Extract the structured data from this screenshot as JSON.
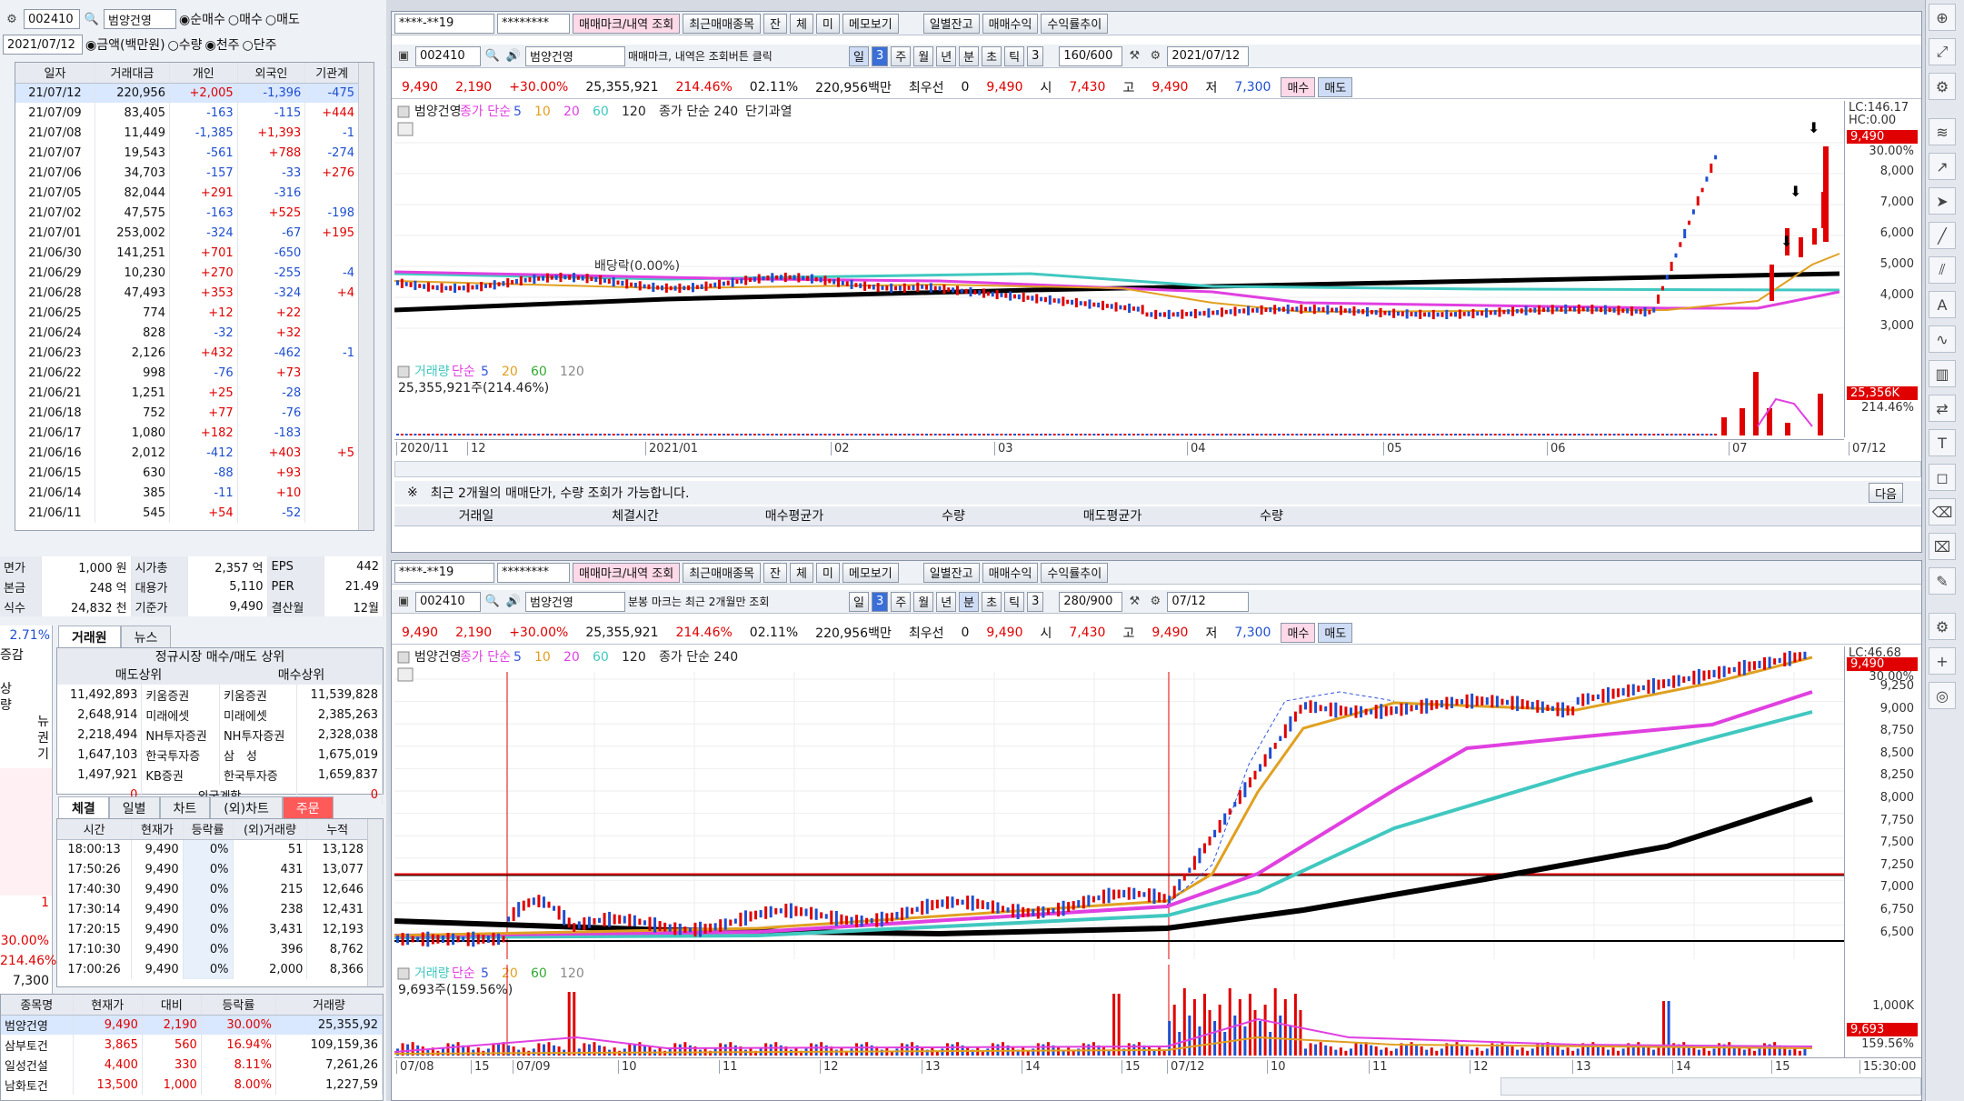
{
  "colors": {
    "up": "#e00000",
    "down": "#1e4fd0",
    "ma5": "#3355dd",
    "ma10": "#e0a020",
    "ma20": "#e040e0",
    "ma60": "#40c8c0",
    "ma240": "#000000"
  },
  "left": {
    "code": "002410",
    "name": "범양건영",
    "net_buy": "순매수",
    "buy": "매수",
    "sell": "매도",
    "date": "2021/07/12",
    "amount": "금액(백만원)",
    "qty": "수량",
    "unit1": "천주",
    "unit2": "단주",
    "investor_headers": [
      "일자",
      "거래대금",
      "개인",
      "외국인",
      "기관계"
    ],
    "investor_rows": [
      [
        "21/07/12",
        "220,956",
        "+2,005",
        "-1,396",
        "-475"
      ],
      [
        "21/07/09",
        "83,405",
        "-163",
        "-115",
        "+444"
      ],
      [
        "21/07/08",
        "11,449",
        "-1,385",
        "+1,393",
        "-1"
      ],
      [
        "21/07/07",
        "19,543",
        "-561",
        "+788",
        "-274"
      ],
      [
        "21/07/06",
        "34,703",
        "-157",
        "-33",
        "+276"
      ],
      [
        "21/07/05",
        "82,044",
        "+291",
        "-316",
        ""
      ],
      [
        "21/07/02",
        "47,575",
        "-163",
        "+525",
        "-198"
      ],
      [
        "21/07/01",
        "253,002",
        "-324",
        "-67",
        "+195"
      ],
      [
        "21/06/30",
        "141,251",
        "+701",
        "-650",
        ""
      ],
      [
        "21/06/29",
        "10,230",
        "+270",
        "-255",
        "-4"
      ],
      [
        "21/06/28",
        "47,493",
        "+353",
        "-324",
        "+4"
      ],
      [
        "21/06/25",
        "774",
        "+12",
        "+22",
        ""
      ],
      [
        "21/06/24",
        "828",
        "-32",
        "+32",
        ""
      ],
      [
        "21/06/23",
        "2,126",
        "+432",
        "-462",
        "-1"
      ],
      [
        "21/06/22",
        "998",
        "-76",
        "+73",
        ""
      ],
      [
        "21/06/21",
        "1,251",
        "+25",
        "-28",
        ""
      ],
      [
        "21/06/18",
        "752",
        "+77",
        "-76",
        ""
      ],
      [
        "21/06/17",
        "1,080",
        "+182",
        "-183",
        ""
      ],
      [
        "21/06/16",
        "2,012",
        "-412",
        "+403",
        "+5"
      ],
      [
        "21/06/15",
        "630",
        "-88",
        "+93",
        ""
      ],
      [
        "21/06/14",
        "385",
        "-11",
        "+10",
        ""
      ],
      [
        "21/06/11",
        "545",
        "+54",
        "-52",
        ""
      ]
    ],
    "info_rows": [
      [
        "면가",
        "1,000 원",
        "시가총",
        "2,357 억",
        "EPS",
        "442"
      ],
      [
        "본금",
        "248 억",
        "대용가",
        "5,110",
        "PER",
        "21.49"
      ],
      [
        "식수",
        "24,832 천",
        "기준가",
        "9,490",
        "결산월",
        "12월"
      ]
    ],
    "side_vals": [
      "2.71%",
      "증감",
      "상",
      "량",
      "뉴",
      "권",
      "기",
      "1",
      "30.00%",
      "214.46%",
      "7,300"
    ],
    "broker_tabs": [
      "거래원",
      "뉴스"
    ],
    "broker_title": "정규시장 매수/매도 상위",
    "broker_sub": [
      "매도상위",
      "매수상위"
    ],
    "broker_rows": [
      [
        "11,492,893",
        "키움증권",
        "키움증권",
        "11,539,828"
      ],
      [
        "2,648,914",
        "미래에셋",
        "미래에셋",
        "2,385,263"
      ],
      [
        "2,218,494",
        "NH투자증권",
        "NH투자증권",
        "2,328,038"
      ],
      [
        "1,647,103",
        "한국투자증",
        "삼　성",
        "1,675,019"
      ],
      [
        "1,497,921",
        "KB증권",
        "한국투자증",
        "1,659,837"
      ]
    ],
    "foreign_total": [
      "0",
      "외국계합",
      "0"
    ],
    "tick_tabs": [
      "체결",
      "일별",
      "차트",
      "(외)차트",
      "주문"
    ],
    "tick_headers": [
      "시간",
      "현재가",
      "등락률",
      "(외)거래량",
      "누적"
    ],
    "tick_rows": [
      [
        "18:00:13",
        "9,490",
        "0%",
        "51",
        "13,128"
      ],
      [
        "17:50:26",
        "9,490",
        "0%",
        "431",
        "13,077"
      ],
      [
        "17:40:30",
        "9,490",
        "0%",
        "215",
        "12,646"
      ],
      [
        "17:30:14",
        "9,490",
        "0%",
        "238",
        "12,431"
      ],
      [
        "17:20:15",
        "9,490",
        "0%",
        "3,431",
        "12,193"
      ],
      [
        "17:10:30",
        "9,490",
        "0%",
        "396",
        "8,762"
      ],
      [
        "17:00:26",
        "9,490",
        "0%",
        "2,000",
        "8,366"
      ]
    ],
    "list_headers": [
      "종목명",
      "현재가",
      "대비",
      "등락률",
      "거래량"
    ],
    "list_rows": [
      [
        "범양건영",
        "9,490",
        "2,190",
        "30.00%",
        "25,355,92"
      ],
      [
        "삼부토건",
        "3,865",
        "560",
        "16.94%",
        "109,159,36"
      ],
      [
        "일성건설",
        "4,400",
        "330",
        "8.11%",
        "7,261,26"
      ],
      [
        "남화토건",
        "13,500",
        "1,000",
        "8.00%",
        "1,227,59"
      ]
    ]
  },
  "top": {
    "acct": "****-**19",
    "pw": "********",
    "btns": [
      "매매마크/내역 조회",
      "최근매매종목",
      "잔",
      "체",
      "미",
      "메모보기",
      "일별잔고",
      "매매수익",
      "수익률추이"
    ],
    "code": "002410",
    "name": "범양건영",
    "hint": "매매마크, 내역은 조회버튼 클릭",
    "period": [
      "일",
      "3",
      "주",
      "월",
      "년",
      "분",
      "초",
      "틱",
      "3"
    ],
    "count": "160/600",
    "date": "2021/07/12",
    "quote": [
      "9,490",
      "2,190",
      "+30.00%",
      "25,355,921",
      "214.46%",
      "02.11%",
      "220,956백만",
      "최우선",
      "0",
      "9,490",
      "시",
      "7,430",
      "고",
      "9,490",
      "저",
      "7,300",
      "매수",
      "매도"
    ],
    "legend": [
      "범양건영",
      "종가 단순",
      "5",
      "10",
      "20",
      "60",
      "120",
      "종가 단순 240",
      "단기과열"
    ],
    "dividend": "배당락(0.00%)",
    "lc": "LC:146.17",
    "hc": "HC:0.00",
    "last": "9,490",
    "lastpct": "30.00%",
    "yticks": [
      "8,000",
      "7,000",
      "6,000",
      "5,000",
      "4,000",
      "3,000"
    ],
    "vol_legend": [
      "거래량",
      "단순",
      "5",
      "20",
      "60",
      "120"
    ],
    "vol_text": "25,355,921주(214.46%)",
    "vol_box": "25,356K",
    "vol_pct": "214.46%",
    "xticks": [
      "2020/11",
      "12",
      "2021/01",
      "02",
      "03",
      "04",
      "05",
      "06",
      "07",
      "07/12"
    ],
    "notice": "최근 2개월의 매매단가, 수량 조회가 가능합니다.",
    "next": "다음",
    "trade_headers": [
      "거래일",
      "체결시간",
      "매수평균가",
      "수량",
      "매도평균가",
      "수량"
    ]
  },
  "bottom": {
    "acct": "****-**19",
    "pw": "********",
    "btns": [
      "매매마크/내역 조회",
      "최근매매종목",
      "잔",
      "체",
      "미",
      "메모보기",
      "일별잔고",
      "매매수익",
      "수익률추이"
    ],
    "code": "002410",
    "name": "범양건영",
    "hint": "분봉 마크는 최근 2개월만 조회",
    "period": [
      "일",
      "3",
      "주",
      "월",
      "년",
      "분",
      "초",
      "틱",
      "3"
    ],
    "count": "280/900",
    "date": "07/12",
    "quote": [
      "9,490",
      "2,190",
      "+30.00%",
      "25,355,921",
      "214.46%",
      "02.11%",
      "220,956백만",
      "최우선",
      "0",
      "9,490",
      "시",
      "7,430",
      "고",
      "9,490",
      "저",
      "7,300",
      "매수",
      "매도"
    ],
    "legend": [
      "범양건영",
      "종가 단순",
      "5",
      "10",
      "20",
      "60",
      "120",
      "종가 단순 240"
    ],
    "lc": "LC:46.68",
    "last": "9,490",
    "lastpct": "30.00%",
    "yticks": [
      "9,250",
      "9,000",
      "8,750",
      "8,500",
      "8,250",
      "8,000",
      "7,750",
      "7,500",
      "7,250",
      "7,000",
      "6,750",
      "6,500"
    ],
    "vol_legend": [
      "거래량",
      "단순",
      "5",
      "20",
      "60",
      "120"
    ],
    "vol_text": "9,693주(159.56%)",
    "vol_tick": "1,000K",
    "vol_box": "9,693",
    "vol_pct": "159.56%",
    "xticks": [
      "07/08",
      "15",
      "07/09",
      "10",
      "11",
      "12",
      "13",
      "14",
      "15",
      "07/12",
      "10",
      "11",
      "12",
      "13",
      "14",
      "15",
      "15:30:00"
    ]
  }
}
